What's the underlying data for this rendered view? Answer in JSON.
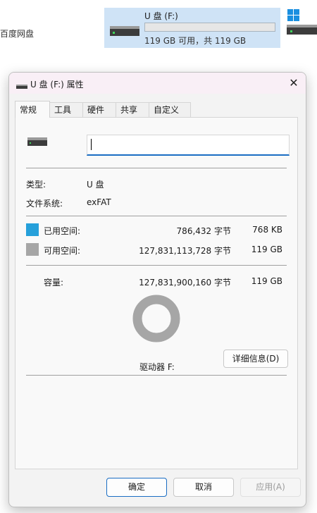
{
  "background": {
    "left_label": "百度网盘",
    "drive": {
      "name": "U 盘 (F:)",
      "usage_fraction": 0.0,
      "info": "119 GB 可用，共 119 GB"
    }
  },
  "dialog": {
    "title": "U 盘 (F:) 属性",
    "close_glyph": "✕",
    "tabs": [
      "常规",
      "工具",
      "硬件",
      "共享",
      "自定义"
    ],
    "active_tab": "常规",
    "name_value": "",
    "type_label": "类型:",
    "type_value": "U 盘",
    "fs_label": "文件系统:",
    "fs_value": "exFAT",
    "used": {
      "label": "已用空间:",
      "bytes": "786,432 字节",
      "size": "768 KB",
      "color": "#26a0da"
    },
    "free": {
      "label": "可用空间:",
      "bytes": "127,831,113,728 字节",
      "size": "119 GB",
      "color": "#a6a6a6"
    },
    "capacity": {
      "label": "容量:",
      "bytes": "127,831,900,160 字节",
      "size": "119 GB"
    },
    "drive_label": "驱动器 F:",
    "details_button": "详细信息(D)",
    "buttons": {
      "ok": "确定",
      "cancel": "取消",
      "apply": "应用(A)"
    }
  }
}
